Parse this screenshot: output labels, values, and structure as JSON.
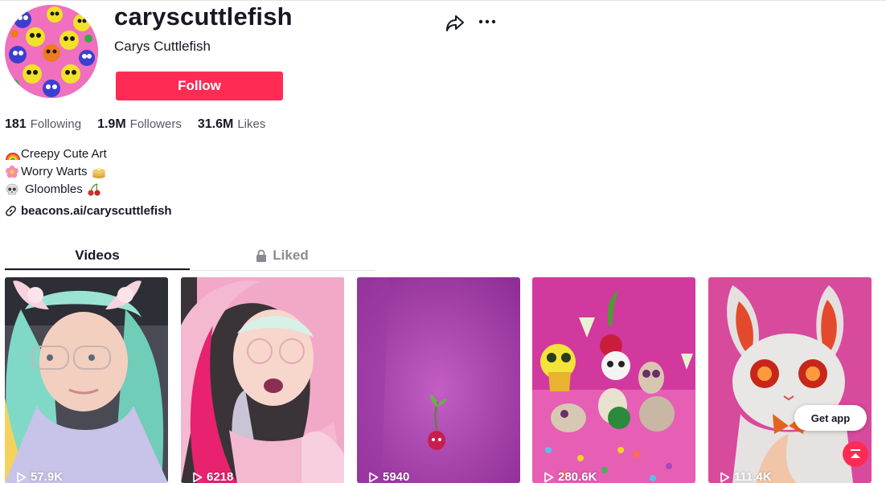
{
  "profile": {
    "username": "caryscuttlefish",
    "nickname": "Carys Cuttlefish",
    "follow_label": "Follow"
  },
  "stats": {
    "following_count": "181",
    "following_label": "Following",
    "followers_count": "1.9M",
    "followers_label": "Followers",
    "likes_count": "31.6M",
    "likes_label": "Likes"
  },
  "bio": {
    "line1": "Creepy Cute Art",
    "line2": "Worry Warts",
    "line3": "Gloombles",
    "line1_icon": "rainbow-emoji",
    "line2_icon": "blossom-emoji",
    "line2_trailing_icon": "pancakes-emoji",
    "line3_icon": "skull-emoji",
    "line3_trailing_icon": "cherries-emoji"
  },
  "link": {
    "text": "beacons.ai/caryscuttlefish",
    "icon": "link-icon"
  },
  "tabs": {
    "videos": "Videos",
    "liked": "Liked",
    "liked_icon": "lock-icon"
  },
  "videos": [
    {
      "views": "57.9K"
    },
    {
      "views": "6218"
    },
    {
      "views": "5940"
    },
    {
      "views": "280.6K"
    },
    {
      "views": "111.4K"
    }
  ],
  "floating": {
    "get_app": "Get app",
    "scroll_top_icon": "arrow-up-to-top-icon"
  },
  "colors": {
    "accent": "#fe2c55",
    "text": "#161823",
    "muted": "#555861"
  }
}
